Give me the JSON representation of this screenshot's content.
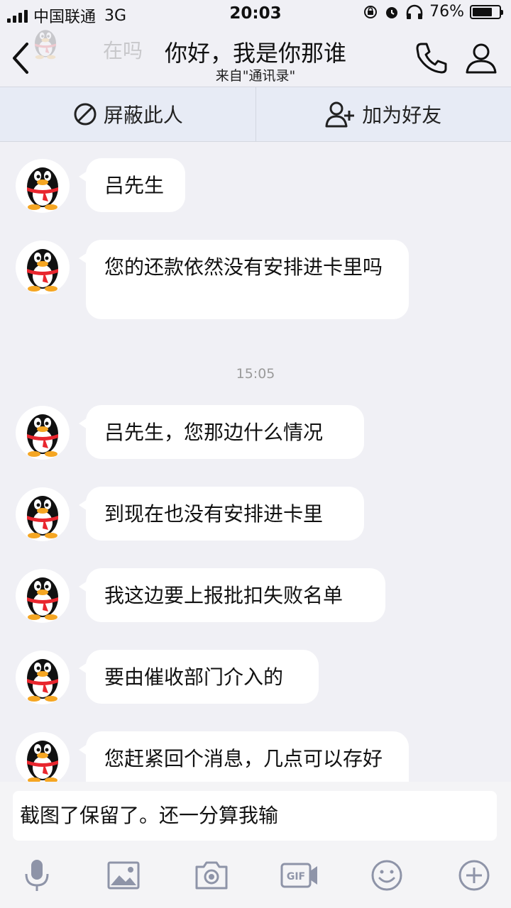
{
  "status_bar": {
    "carrier": "中国联通",
    "network": "3G",
    "time": "20:03",
    "battery": "76%",
    "battery_level": 0.76,
    "icons": [
      "signal-icon",
      "orientation-lock-icon",
      "alarm-icon",
      "headphones-icon",
      "battery-icon"
    ]
  },
  "nav": {
    "background_message": "在吗",
    "title": "你好，我是你那谁",
    "subtitle": "来自\"通讯录\"",
    "icons": [
      "back-icon",
      "phone-icon",
      "profile-icon"
    ]
  },
  "actions": {
    "block": "屏蔽此人",
    "add_friend": "加为好友"
  },
  "messages": [
    {
      "text": "吕先生"
    },
    {
      "text": "您的还款依然没有安排进卡里吗"
    },
    {
      "text": "吕先生，您那边什么情况"
    },
    {
      "text": "到现在也没有安排进卡里"
    },
    {
      "text": "我这边要上报批扣失败名单"
    },
    {
      "text": "要由催收部门介入的"
    },
    {
      "text": "您赶紧回个消息，几点可以存好"
    }
  ],
  "timestamp": "15:05",
  "input": {
    "value": "截图了保留了。还一分算我输"
  },
  "toolbar": [
    "microphone-icon",
    "image-icon",
    "camera-icon",
    "gif-icon",
    "emoji-icon",
    "plus-icon"
  ],
  "colors": {
    "background": "#f0f0f5",
    "action_bar": "#e7ebf5",
    "bubble": "#ffffff",
    "icon": "#8e94a8",
    "penguin_scarf": "#e8262e",
    "penguin_beak": "#f5a623"
  }
}
